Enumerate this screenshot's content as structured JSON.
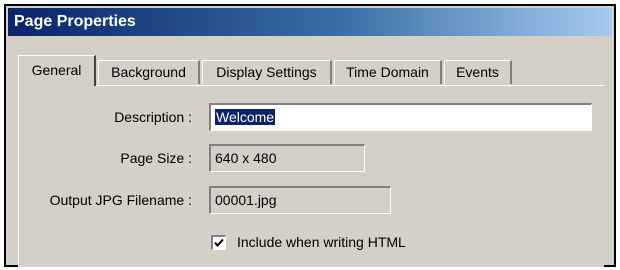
{
  "window": {
    "title": "Page Properties"
  },
  "tabs": [
    {
      "label": "General",
      "active": true
    },
    {
      "label": "Background"
    },
    {
      "label": "Display Settings"
    },
    {
      "label": "Time Domain"
    },
    {
      "label": "Events"
    }
  ],
  "form": {
    "description": {
      "label": "Description :",
      "value": "Welcome"
    },
    "page_size": {
      "label": "Page Size :",
      "value": "640 x 480"
    },
    "output_filename": {
      "label": "Output JPG Filename :",
      "value": "00001.jpg"
    },
    "include_html": {
      "label": "Include when writing HTML",
      "checked": true
    }
  },
  "colors": {
    "titlebar_start": "#0a246a",
    "dialog_face": "#d4d0c8",
    "selection": "#0a246a"
  }
}
